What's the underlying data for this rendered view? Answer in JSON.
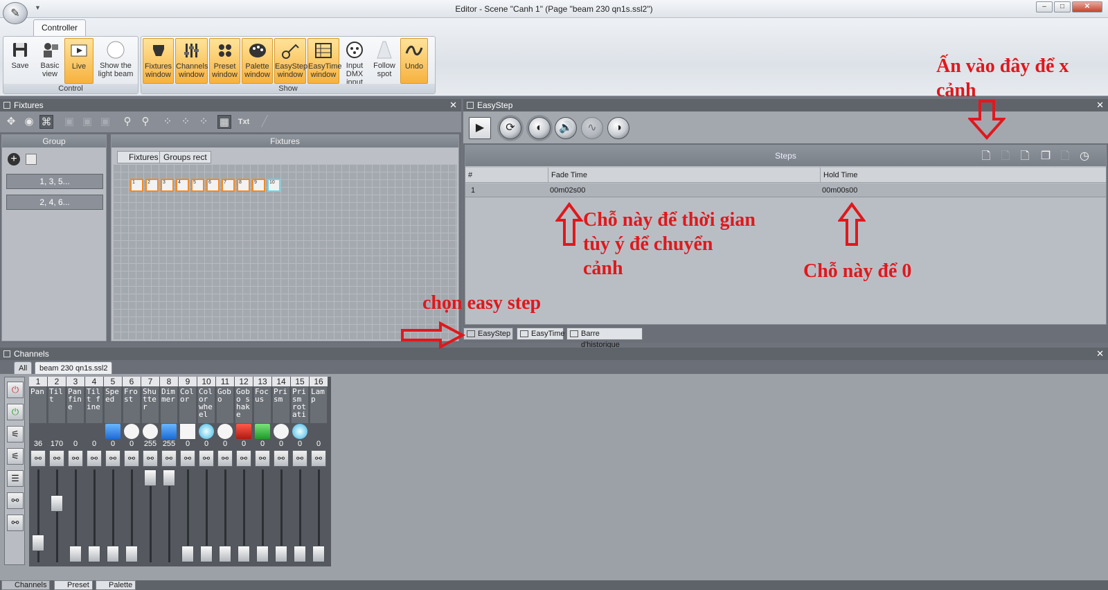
{
  "window": {
    "title": "Editor - Scene \"Canh 1\" (Page \"beam 230 qn1s.ssl2\")",
    "min": "–",
    "max": "□",
    "close": "✕"
  },
  "ribbon": {
    "tab": "Controller",
    "groups": {
      "control": "Control",
      "show": "Show"
    },
    "buttons": {
      "save": "Save",
      "basic_view": "Basic view",
      "live": "Live",
      "show_light_beam": "Show the light beam",
      "fixtures_window": "Fixtures window",
      "channels_window": "Channels window",
      "preset_window": "Preset window",
      "palette_window": "Palette window",
      "easystep_window": "EasyStep window",
      "easytime_window": "EasyTime window",
      "input_dmx_input": "Input DMX input",
      "follow_spot": "Follow spot",
      "undo": "Undo"
    }
  },
  "fixtures_panel": {
    "title": "Fixtures",
    "group_header": "Group",
    "fixtures_header": "Fixtures",
    "txt_label": "Txt",
    "groups": [
      "1, 3, 5...",
      "2, 4, 6..."
    ],
    "tabs": [
      "Fixtures",
      "Groups rect"
    ],
    "fixtures": [
      "1",
      "2",
      "3",
      "4",
      "5",
      "6",
      "7",
      "8",
      "9",
      "10"
    ]
  },
  "easystep_panel": {
    "title": "EasyStep",
    "steps_title": "Steps",
    "columns": {
      "num": "#",
      "fade": "Fade Time",
      "hold": "Hold Time"
    },
    "rows": [
      {
        "num": "1",
        "fade": "00m02s00",
        "hold": "00m00s00"
      }
    ],
    "bottom_tabs": [
      "EasyStep",
      "EasyTime",
      "Barre d'historique"
    ]
  },
  "channels_panel": {
    "title": "Channels",
    "tabs": [
      "All",
      "beam 230 qn1s.ssl2"
    ],
    "channels": [
      {
        "num": "1",
        "name": "Pan",
        "value": "36",
        "icon": "none",
        "level": 36
      },
      {
        "num": "2",
        "name": "Tilt",
        "value": "170",
        "icon": "none",
        "level": 170
      },
      {
        "num": "3",
        "name": "Pan fine",
        "value": "0",
        "icon": "none",
        "level": 0
      },
      {
        "num": "4",
        "name": "Tilt fine",
        "value": "0",
        "icon": "none",
        "level": 0
      },
      {
        "num": "5",
        "name": "Speed",
        "value": "0",
        "icon": "blue",
        "level": 0
      },
      {
        "num": "6",
        "name": "Frost",
        "value": "0",
        "icon": "white",
        "level": 0
      },
      {
        "num": "7",
        "name": "Shutter",
        "value": "255",
        "icon": "white",
        "level": 255
      },
      {
        "num": "8",
        "name": "Dimmer",
        "value": "255",
        "icon": "blue",
        "level": 255
      },
      {
        "num": "9",
        "name": "Color",
        "value": "0",
        "icon": "sq",
        "level": 0
      },
      {
        "num": "10",
        "name": "Color wheel",
        "value": "0",
        "icon": "cyan",
        "level": 0
      },
      {
        "num": "11",
        "name": "Gobo",
        "value": "0",
        "icon": "white",
        "level": 0
      },
      {
        "num": "12",
        "name": "Gobo shake",
        "value": "0",
        "icon": "red",
        "level": 0
      },
      {
        "num": "13",
        "name": "Focus",
        "value": "0",
        "icon": "green",
        "level": 0
      },
      {
        "num": "14",
        "name": "Prism",
        "value": "0",
        "icon": "white",
        "level": 0
      },
      {
        "num": "15",
        "name": "Prism rotati",
        "value": "0",
        "icon": "cyan",
        "level": 0
      },
      {
        "num": "16",
        "name": "Lamp",
        "value": "0",
        "icon": "none",
        "level": 0
      }
    ]
  },
  "bottom_tabs": [
    "Channels",
    "Preset",
    "Palette"
  ],
  "annotations": {
    "top_right": "Ấn vào đây để x cảnh",
    "fade_note": "Chỗ này để thời gian tùy ý để chuyển cảnh",
    "hold_note": "Chỗ này để 0",
    "choose_easystep": "chọn easy step"
  }
}
